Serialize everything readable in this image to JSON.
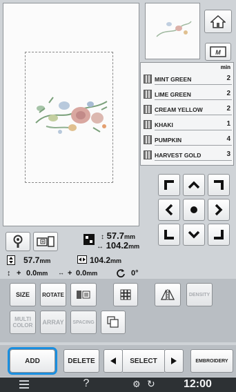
{
  "colors_header": "min",
  "thread_colors": [
    {
      "name": "MINT GREEN",
      "count": "2"
    },
    {
      "name": "LIME GREEN",
      "count": "2"
    },
    {
      "name": "CREAM YELLOW",
      "count": "2"
    },
    {
      "name": "KHAKI",
      "count": "1"
    },
    {
      "name": "PUMPKIN",
      "count": "4"
    },
    {
      "name": "HARVEST GOLD",
      "count": "3"
    }
  ],
  "size_info": {
    "width": "57.7",
    "height": "104.2",
    "unit": "mm"
  },
  "dimension_row": {
    "height_value": "57.7",
    "width_value": "104.2",
    "unit": "mm"
  },
  "position_row": {
    "plus": "+",
    "x_value": "0.0",
    "y_value": "0.0",
    "unit": "mm",
    "angle": "0°"
  },
  "buttons": {
    "size": "SIZE",
    "rotate": "ROTATE",
    "density": "DENSITY",
    "multi_color_line1": "MULTI",
    "multi_color_line2": "COLOR",
    "array": "ARRAY",
    "spacing": "SPACING",
    "add": "ADD",
    "delete": "DELETE",
    "select": "SELECT",
    "embroidery": "EMBROIDERY"
  },
  "status": {
    "question": "?",
    "time": "12:00"
  },
  "accent_color": "#1a8fe0"
}
